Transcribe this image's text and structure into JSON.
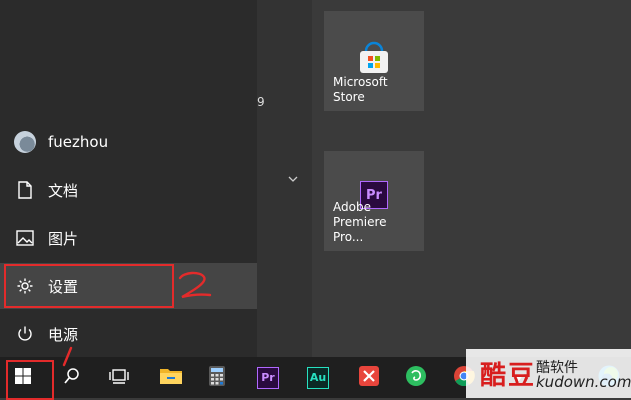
{
  "user": {
    "name": "fuezhou"
  },
  "menu": {
    "documents": "文档",
    "pictures": "图片",
    "settings": "设置",
    "power": "电源"
  },
  "middle": {
    "letter": "9"
  },
  "tiles": {
    "store": "Microsoft Store",
    "premiere": "Adobe\nPremiere Pro..."
  },
  "annotations": {
    "step1": "1",
    "step2": "2"
  },
  "watermark": {
    "brand": "酷软件",
    "url": "kudown.com"
  },
  "colors": {
    "annotation": "#e32b2b",
    "active_item": "#454545",
    "taskbar": "#1f1f1f"
  }
}
